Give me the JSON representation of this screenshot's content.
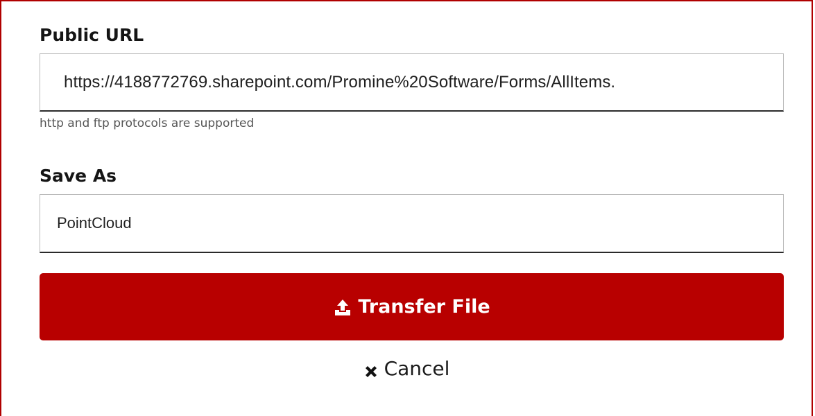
{
  "form": {
    "public_url_label": "Public URL",
    "public_url_value": "https://4188772769.sharepoint.com/Promine%20Software/Forms/AllItems.",
    "public_url_hint": "http and ftp protocols are supported",
    "save_as_label": "Save As",
    "save_as_value": "PointCloud",
    "transfer_label": "Transfer File",
    "cancel_label": "Cancel"
  },
  "icons": {
    "transfer": "upload-icon",
    "cancel": "close-icon"
  },
  "colors": {
    "accent": "#b80000",
    "frame_border": "#b00000"
  }
}
